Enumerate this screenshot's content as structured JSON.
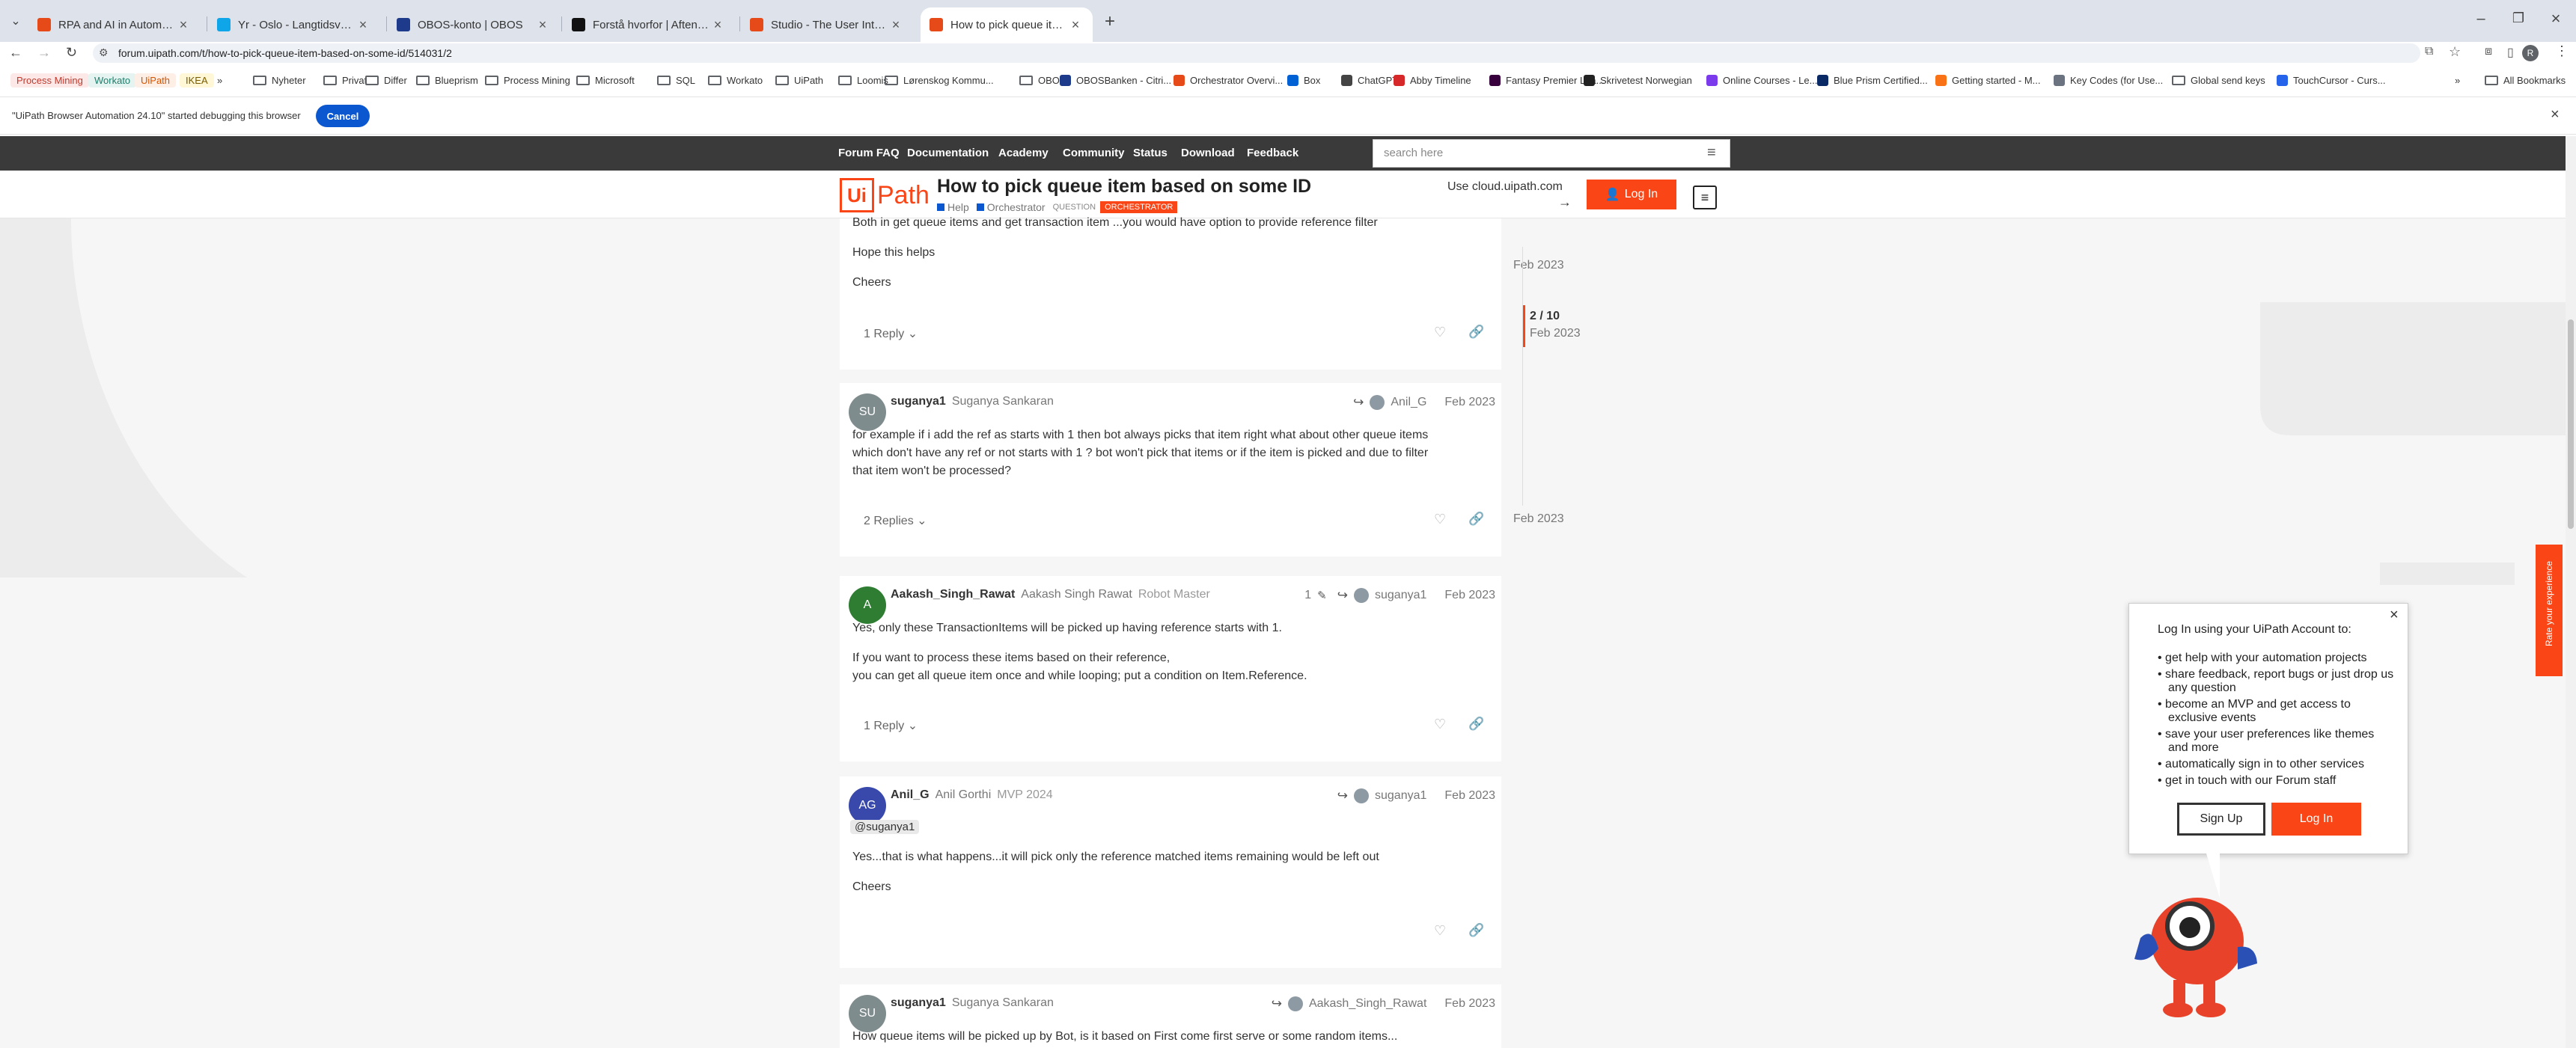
{
  "browser": {
    "tabs": [
      {
        "title": "RPA and AI in Automation Trai...",
        "color": "#e64a19"
      },
      {
        "title": "Yr - Oslo - Langtidsvarsel",
        "color": "#0ea5e9"
      },
      {
        "title": "OBOS-konto | OBOS",
        "color": "#1e3a8a"
      },
      {
        "title": "Forstå hvorfor | Aftenposten",
        "color": "#111111"
      },
      {
        "title": "Studio - The User Interface",
        "color": "#e64a19"
      },
      {
        "title": "How to pick queue item based",
        "color": "#e64a19"
      }
    ],
    "url": "forum.uipath.com/t/how-to-pick-queue-item-based-on-some-id/514031/2",
    "profile_initial": "R",
    "bookmarks": [
      {
        "label": "Process Mining",
        "kind": "pill",
        "color": "#fde8e8",
        "text": "#c0392b"
      },
      {
        "label": "Workato",
        "kind": "pill",
        "color": "#e6f4f1",
        "text": "#1b7f6b"
      },
      {
        "label": "UiPath",
        "kind": "pill",
        "color": "#fdeee6",
        "text": "#d35400"
      },
      {
        "label": "IKEA",
        "kind": "pill",
        "color": "#fff7d6",
        "text": "#7a5c00"
      },
      {
        "label": "»",
        "kind": "text"
      },
      {
        "label": "Nyheter",
        "kind": "folder"
      },
      {
        "label": "Privat",
        "kind": "folder"
      },
      {
        "label": "Differ",
        "kind": "folder"
      },
      {
        "label": "Blueprism",
        "kind": "folder"
      },
      {
        "label": "Process Mining",
        "kind": "folder"
      },
      {
        "label": "Microsoft",
        "kind": "folder"
      },
      {
        "label": "SQL",
        "kind": "folder"
      },
      {
        "label": "Workato",
        "kind": "folder"
      },
      {
        "label": "UiPath",
        "kind": "folder"
      },
      {
        "label": "Loomis",
        "kind": "folder"
      },
      {
        "label": "Lørenskog Kommu...",
        "kind": "folder"
      },
      {
        "label": "OBOS",
        "kind": "folder"
      },
      {
        "label": "OBOSBanken - Citri...",
        "kind": "icon",
        "color": "#1e3a8a"
      },
      {
        "label": "Orchestrator Overvi...",
        "kind": "icon",
        "color": "#e64a19"
      },
      {
        "label": "Box",
        "kind": "icon",
        "color": "#0061d5"
      },
      {
        "label": "ChatGPT",
        "kind": "icon",
        "color": "#444444"
      },
      {
        "label": "Abby Timeline",
        "kind": "icon",
        "color": "#d62828"
      },
      {
        "label": "Fantasy Premier Lea...",
        "kind": "icon",
        "color": "#37003c"
      },
      {
        "label": "Skrivetest Norwegian",
        "kind": "icon",
        "color": "#222222"
      },
      {
        "label": "Online Courses - Le...",
        "kind": "icon",
        "color": "#7c3aed"
      },
      {
        "label": "Blue Prism Certified...",
        "kind": "icon",
        "color": "#0a2a66"
      },
      {
        "label": "Getting started - M...",
        "kind": "icon",
        "color": "#f97316"
      },
      {
        "label": "Key Codes (for Use...",
        "kind": "icon",
        "color": "#6b7280"
      },
      {
        "label": "Global send keys",
        "kind": "folder"
      },
      {
        "label": "TouchCursor - Curs...",
        "kind": "icon",
        "color": "#2563eb"
      },
      {
        "label": "»",
        "kind": "text"
      },
      {
        "label": "All Bookmarks",
        "kind": "folder"
      }
    ],
    "debug_message": "\"UiPath Browser Automation 24.10\" started debugging this browser",
    "debug_cancel": "Cancel"
  },
  "forum": {
    "nav": [
      "Forum FAQ",
      "Documentation",
      "Academy",
      "Community",
      "Status",
      "Download",
      "Feedback"
    ],
    "search_placeholder": "search here",
    "logo_text": "UiPath",
    "topic_title": "How to pick queue item based on some ID",
    "tags": {
      "cat1": "Help",
      "cat2": "Orchestrator",
      "tag1": "QUESTION",
      "tag2": "ORCHESTRATOR"
    },
    "use_cloud": "Use cloud.uipath.com",
    "use_cloud_arrow": "→",
    "login": "Log In",
    "colors": {
      "accent": "#fa4616",
      "dark": "#3a3a3a"
    }
  },
  "posts": [
    {
      "partial": true,
      "lines": [
        "Both in get queue items and get transaction item ...you would have option to provide reference filter",
        "Hope this helps",
        "Cheers"
      ],
      "replies": "1 Reply"
    },
    {
      "avatar": "SU",
      "avatar_color": "#7f8c8d",
      "username": "suganya1",
      "fullname": "Suganya Sankaran",
      "title": "",
      "reply_to": "Anil_G",
      "edits": "",
      "date": "Feb 2023",
      "lines": [
        "for example if i add the ref as starts with 1 then bot always picks that item right what about other queue items",
        "which don't have any ref or not starts with 1 ? bot won't pick that items or if the item is picked and due to filter",
        "that item won't be processed?"
      ],
      "replies": "2 Replies"
    },
    {
      "avatar": "A",
      "avatar_color": "#2e7d32",
      "username": "Aakash_Singh_Rawat",
      "fullname": "Aakash Singh Rawat",
      "title": "Robot Master",
      "reply_to": "suganya1",
      "edits": "1",
      "date": "Feb 2023",
      "lines": [
        "Yes, only these TransactionItems will be picked up having reference starts with 1.",
        "If you want to process these items based on their reference,",
        "you can get all queue item once and while looping; put a condition on Item.Reference."
      ],
      "replies": "1 Reply"
    },
    {
      "avatar": "AG",
      "avatar_color": "#3949ab",
      "username": "Anil_G",
      "fullname": "Anil Gorthi",
      "title": "MVP 2024",
      "reply_to": "suganya1",
      "edits": "",
      "date": "Feb 2023",
      "mention": "@suganya1",
      "lines": [
        "Yes...that is what happens...it will pick only the reference matched items remaining would be left out",
        "Cheers"
      ],
      "replies": ""
    },
    {
      "avatar": "SU",
      "avatar_color": "#7f8c8d",
      "username": "suganya1",
      "fullname": "Suganya Sankaran",
      "title": "",
      "reply_to": "Aakash_Singh_Rawat",
      "edits": "",
      "date": "Feb 2023",
      "lines": [
        "How queue items will be picked up by Bot, is it based on First come first serve or some random items..."
      ]
    }
  ],
  "timeline": {
    "top_date": "Feb 2023",
    "position": "2 / 10",
    "position_date": "Feb 2023",
    "bottom_date": "Feb 2023"
  },
  "login_popup": {
    "title": "Log In using your UiPath Account to:",
    "items": [
      "get help with your automation projects",
      "share feedback, report bugs or just drop us any question",
      "become an MVP and get access to exclusive events",
      "save your user preferences like themes and more",
      "automatically sign in to other services",
      "get in touch with our Forum staff"
    ],
    "signup": "Sign Up",
    "login": "Log In",
    "close": "×"
  },
  "rate_tab": "Rate your experience"
}
